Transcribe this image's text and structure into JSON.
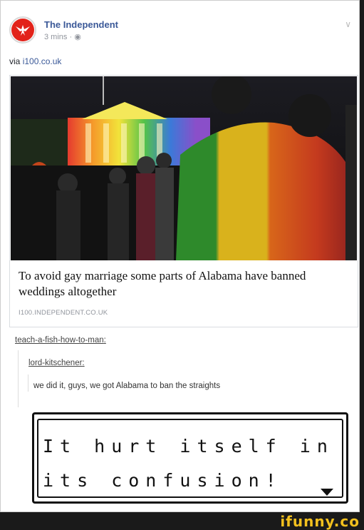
{
  "post": {
    "page_name": "The Independent",
    "meta": "3 mins · ",
    "privacy_icon": "globe-icon",
    "via_prefix": "via ",
    "via_link": "i100.co.uk"
  },
  "link": {
    "headline": "To avoid gay marriage some parts of Alabama have banned weddings altogether",
    "domain": "I100.INDEPENDENT.CO.UK"
  },
  "tumblr": {
    "user1": "teach-a-fish-how-to-man",
    "user2": "lord-kitschener",
    "reply": "we did it, guys, we got Alabama to ban the straights"
  },
  "pokemon_box": {
    "line1": "It hurt itself in",
    "line2": "its confusion!"
  },
  "watermark": {
    "text": "ifunny.co"
  },
  "colors": {
    "brand_link": "#3b5998",
    "logo_red": "#e2231a",
    "watermark_yellow": "#f2c01e"
  }
}
